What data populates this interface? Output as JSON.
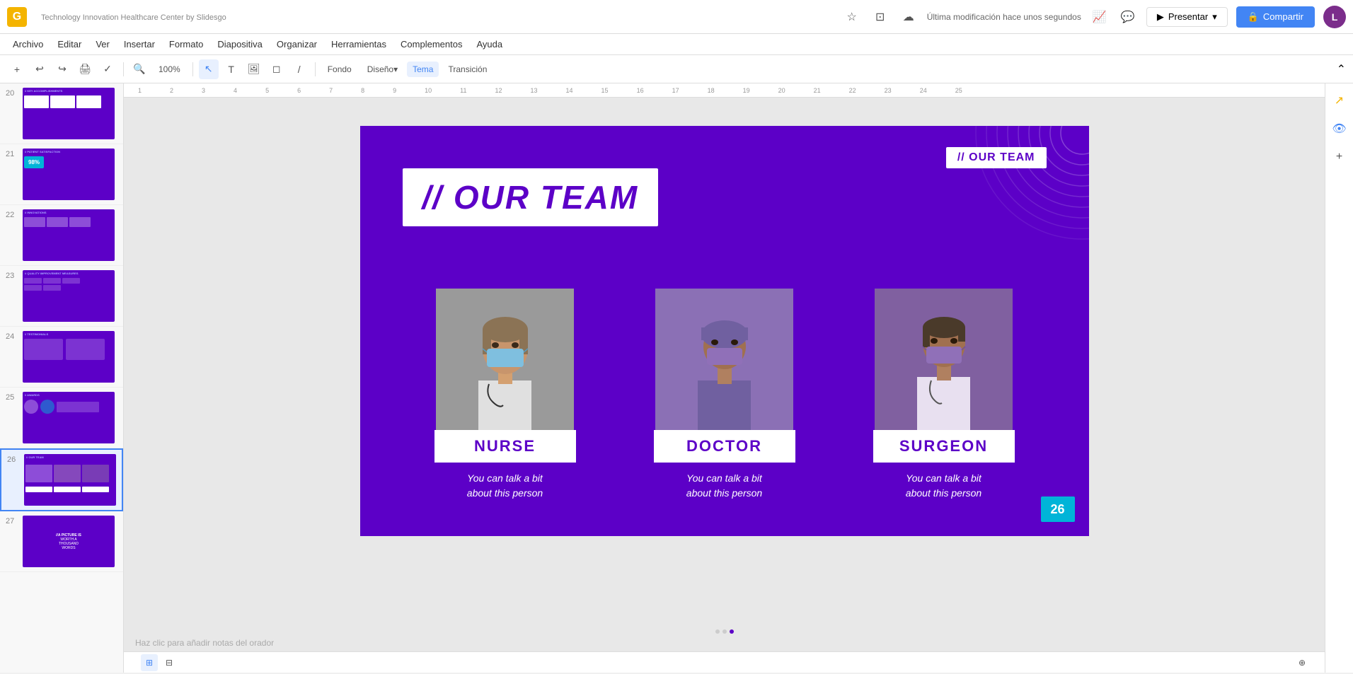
{
  "app": {
    "logo": "G",
    "title": "Technology Innovation Healthcare Center by Slidesgo",
    "last_saved": "Última modificación hace unos segundos"
  },
  "menu": {
    "items": [
      "Archivo",
      "Editar",
      "Ver",
      "Insertar",
      "Formato",
      "Diapositiva",
      "Organizar",
      "Herramientas",
      "Complementos",
      "Ayuda"
    ]
  },
  "toolbar": {
    "mode_label": "Fondo",
    "design_label": "Diseño",
    "theme_label": "Tema",
    "transition_label": "Transición"
  },
  "header_buttons": {
    "present": "Presentar",
    "share": "Compartir",
    "user_initial": "L"
  },
  "slide": {
    "background_color": "#5c00c7",
    "title": "// OUR TEAM",
    "top_right_label": "// OUR TEAM",
    "page_number": "26",
    "team_members": [
      {
        "id": "nurse",
        "name": "NURSE",
        "description": "You can talk a bit\nabout this person",
        "photo_color": "#9a9a9a"
      },
      {
        "id": "doctor",
        "name": "DOCTOR",
        "description": "You can talk a bit\nabout this person",
        "photo_color": "#8b70b0"
      },
      {
        "id": "surgeon",
        "name": "SURGEON",
        "description": "You can talk a bit\nabout this person",
        "photo_color": "#8060a0"
      }
    ]
  },
  "thumbnails": [
    {
      "number": "20",
      "label": "KEY ACCOMPLISHMENTS"
    },
    {
      "number": "21",
      "label": "PATIENT SATISFACTION",
      "has_percent": "98%"
    },
    {
      "number": "22",
      "label": "INNOVATIONS"
    },
    {
      "number": "23",
      "label": "QUALITY IMPROVEMENT MEASURES"
    },
    {
      "number": "24",
      "label": "TESTIMONIALS"
    },
    {
      "number": "25",
      "label": "AWARDS"
    },
    {
      "number": "26",
      "label": "OUR TEAM",
      "active": true
    },
    {
      "number": "27",
      "label": "PICTURE"
    }
  ],
  "status_bar": {
    "notes_placeholder": "Haz clic para añadir notas del orador"
  }
}
